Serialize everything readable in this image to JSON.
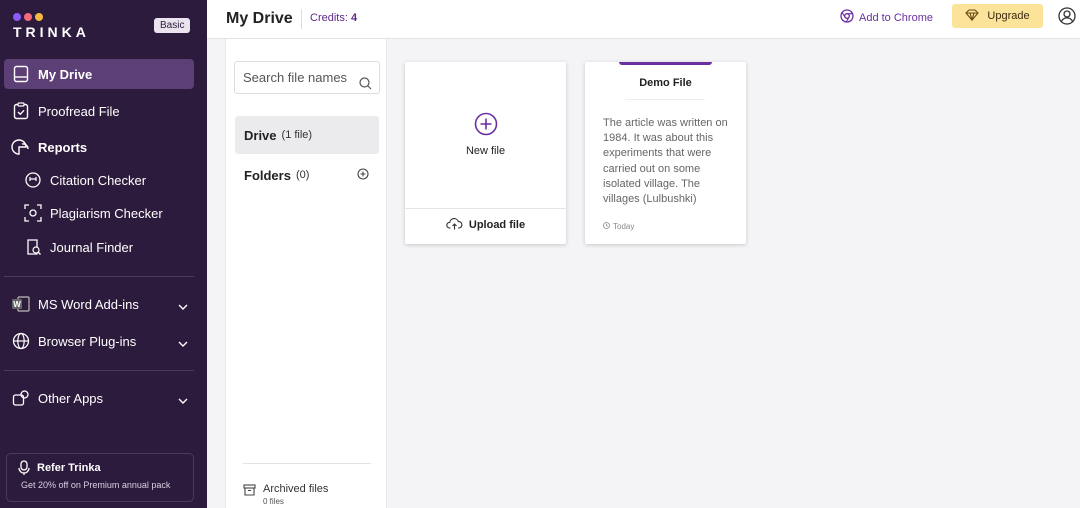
{
  "brand": {
    "name": "TRINKA",
    "plan": "Basic",
    "dot_colors": [
      "#8a5cf5",
      "#f36a7a",
      "#f5b941"
    ]
  },
  "sidebar": {
    "items": [
      {
        "label": "My Drive",
        "icon": "drive-icon"
      },
      {
        "label": "Proofread File",
        "icon": "proofread-icon"
      },
      {
        "label": "Reports",
        "icon": "reports-icon"
      },
      {
        "label": "Citation Checker",
        "icon": "citation-icon"
      },
      {
        "label": "Plagiarism Checker",
        "icon": "plagiarism-icon"
      },
      {
        "label": "Journal Finder",
        "icon": "journal-icon"
      },
      {
        "label": "MS Word Add-ins",
        "icon": "word-icon"
      },
      {
        "label": "Browser Plug-ins",
        "icon": "globe-icon"
      },
      {
        "label": "Other Apps",
        "icon": "apps-icon"
      }
    ],
    "refer": {
      "title": "Refer Trinka",
      "subtitle": "Get 20% off on Premium annual pack"
    }
  },
  "header": {
    "title": "My Drive",
    "credits_label": "Credits:",
    "credits_value": "4",
    "add_chrome": "Add to Chrome",
    "upgrade": "Upgrade"
  },
  "files_panel": {
    "search_placeholder": "Search file names",
    "drive_label": "Drive",
    "drive_count": "(1 file)",
    "folders_label": "Folders",
    "folders_count": "(0)",
    "archived_label": "Archived files",
    "archived_count": "0 files"
  },
  "cards": {
    "new_file": "New file",
    "upload_file": "Upload file",
    "demo": {
      "name": "Demo File",
      "preview": "The article was written on 1984. It was about this experiments that were carried out on some isolated village. The villages (Lulbushki)",
      "date": "Today"
    }
  },
  "colors": {
    "sidebar_bg": "#2d1b3d",
    "accent": "#6b2fa0",
    "upgrade_bg": "#fbe39a"
  }
}
